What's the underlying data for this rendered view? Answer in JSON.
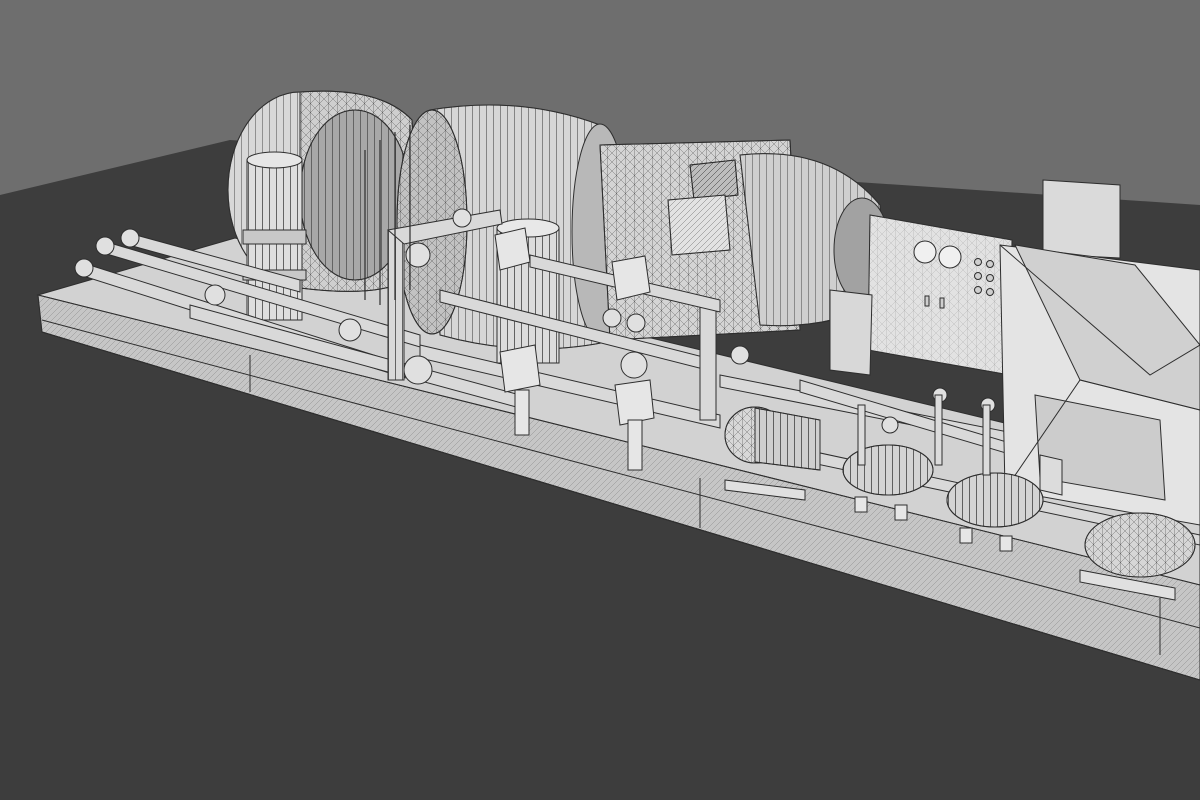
{
  "scene": {
    "subject": "industrial-turbine-generator-skid",
    "render_style": "wireframe-on-shaded",
    "colors": {
      "backdrop": "#6e6e6e",
      "floor": "#3d3d3d",
      "model_light": "#dcdcdc",
      "model_mid": "#c4c4c4",
      "model_shadow": "#9a9a9a",
      "wire": "#2e2e2e"
    }
  }
}
